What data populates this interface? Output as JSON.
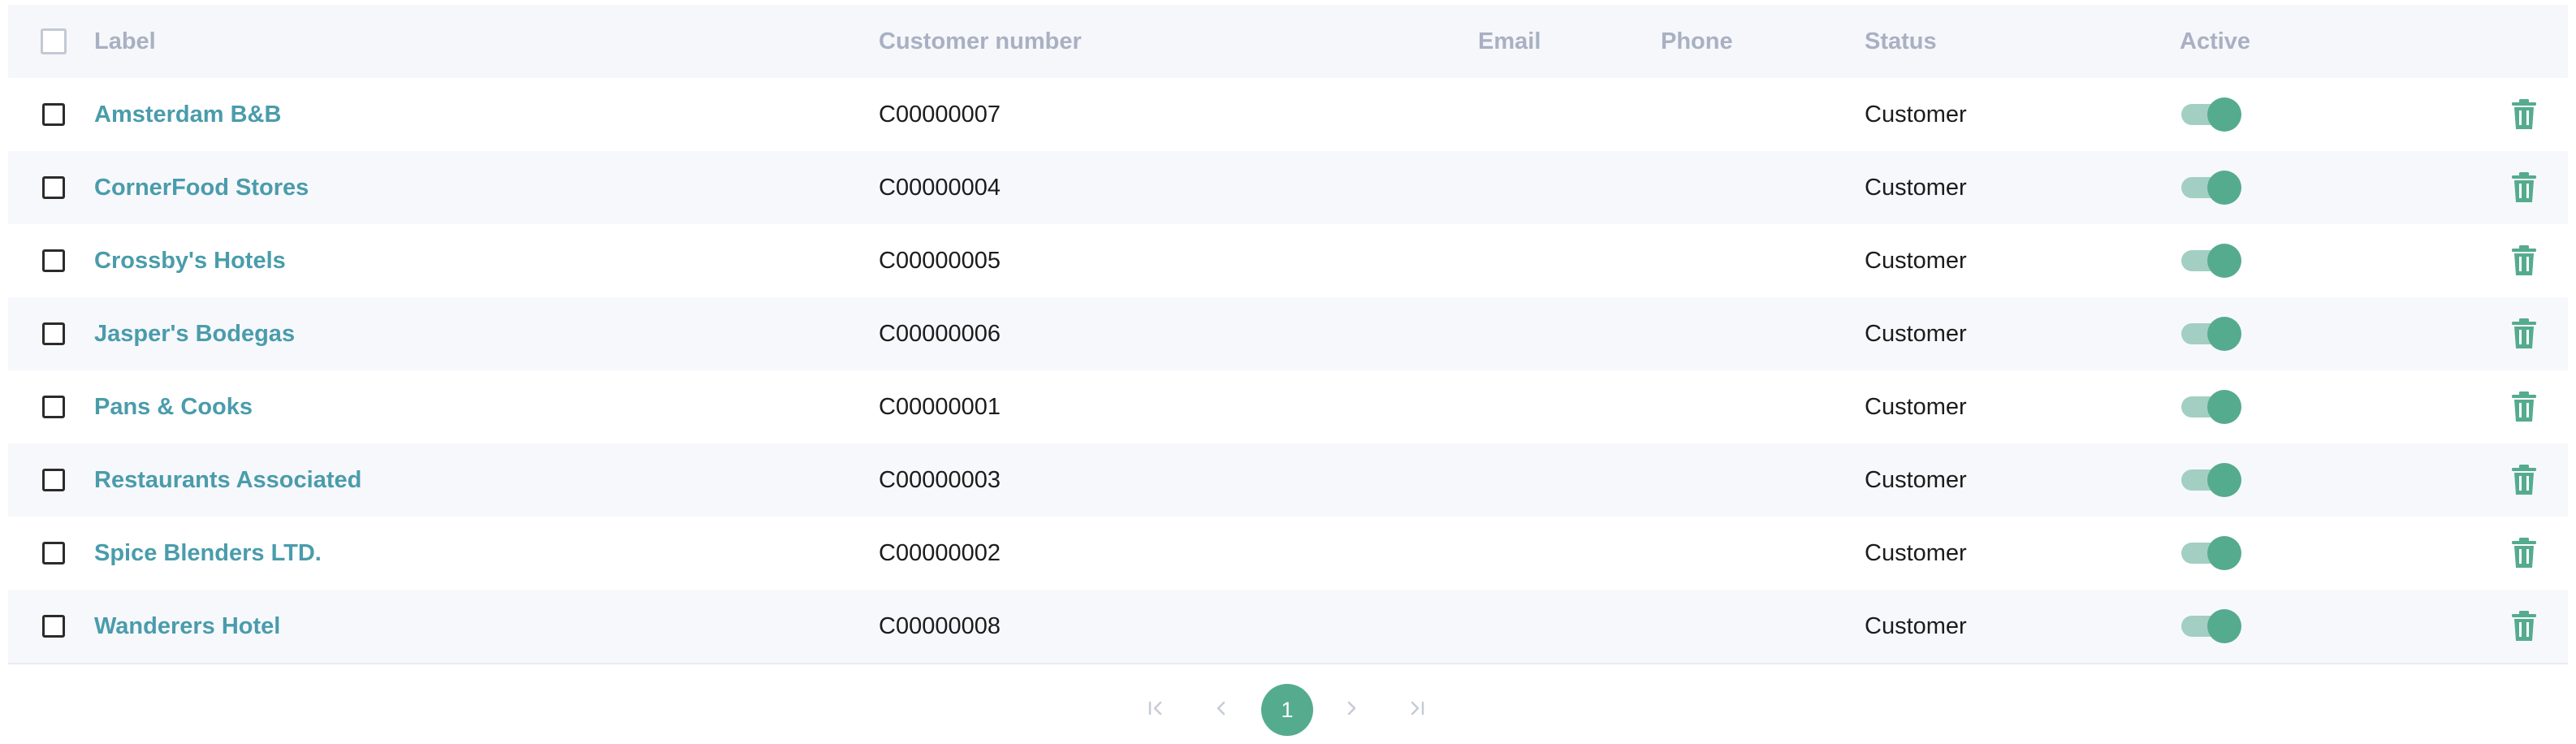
{
  "table": {
    "columns": {
      "label": "Label",
      "customer_number": "Customer number",
      "email": "Email",
      "phone": "Phone",
      "status": "Status",
      "active": "Active"
    },
    "rows": [
      {
        "label": "Amsterdam B&B",
        "customer_number": "C00000007",
        "email": "",
        "phone": "",
        "status": "Customer",
        "active": true
      },
      {
        "label": "CornerFood Stores",
        "customer_number": "C00000004",
        "email": "",
        "phone": "",
        "status": "Customer",
        "active": true
      },
      {
        "label": "Crossby's Hotels",
        "customer_number": "C00000005",
        "email": "",
        "phone": "",
        "status": "Customer",
        "active": true
      },
      {
        "label": "Jasper's Bodegas",
        "customer_number": "C00000006",
        "email": "",
        "phone": "",
        "status": "Customer",
        "active": true
      },
      {
        "label": "Pans & Cooks",
        "customer_number": "C00000001",
        "email": "",
        "phone": "",
        "status": "Customer",
        "active": true
      },
      {
        "label": "Restaurants Associated",
        "customer_number": "C00000003",
        "email": "",
        "phone": "",
        "status": "Customer",
        "active": true
      },
      {
        "label": "Spice Blenders LTD.",
        "customer_number": "C00000002",
        "email": "",
        "phone": "",
        "status": "Customer",
        "active": true
      },
      {
        "label": "Wanderers Hotel",
        "customer_number": "C00000008",
        "email": "",
        "phone": "",
        "status": "Customer",
        "active": true
      }
    ]
  },
  "pagination": {
    "current_page": "1"
  },
  "icons": {
    "row_delete": "trash-icon",
    "first_page": "first-page-icon",
    "prev_page": "chevron-left-icon",
    "next_page": "chevron-right-icon",
    "last_page": "last-page-icon"
  },
  "colors": {
    "accent": "#55ab8e",
    "link": "#4a9cab",
    "header_text": "#a9b0c2",
    "toggle_track": "#a3cfc3"
  }
}
